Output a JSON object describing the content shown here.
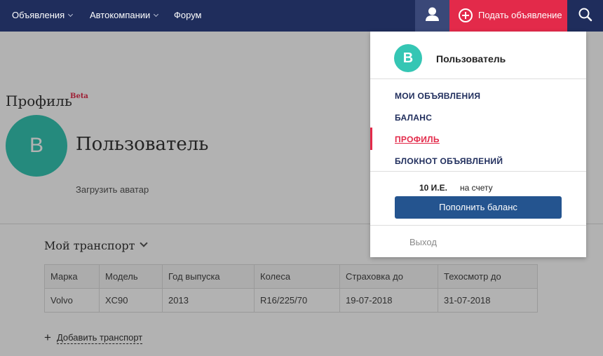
{
  "topnav": {
    "items": [
      {
        "label": "Объявления"
      },
      {
        "label": "Автокомпании"
      },
      {
        "label": "Форум"
      }
    ],
    "post_ad_label": "Подать объявление"
  },
  "profile": {
    "title": "Профиль",
    "beta": "Beta",
    "avatar_letter": "В",
    "user_name": "Пользователь",
    "upload_avatar": "Загрузить аватар"
  },
  "transport": {
    "title": "Мой транспорт",
    "columns": [
      "Марка",
      "Модель",
      "Год выпуска",
      "Колеса",
      "Страховка до",
      "Техосмотр до"
    ],
    "rows": [
      [
        "Volvo",
        "XC90",
        "2013",
        "R16/225/70",
        "19-07-2018",
        "31-07-2018"
      ]
    ],
    "add_label": "Добавить транспорт"
  },
  "dropdown": {
    "avatar_letter": "В",
    "user_name": "Пользователь",
    "menu": [
      {
        "label": "МОИ ОБЪЯВЛЕНИЯ",
        "active": false
      },
      {
        "label": "БАЛАНС",
        "active": false
      },
      {
        "label": "ПРОФИЛЬ",
        "active": true
      },
      {
        "label": "БЛОКНОТ ОБЪЯВЛЕНИЙ",
        "active": false
      }
    ],
    "balance_amount": "10 И.Е.",
    "balance_suffix": "на счету",
    "topup_label": "Пополнить баланс",
    "logout_label": "Выход"
  },
  "colors": {
    "nav_bg": "#1f2d5c",
    "accent_red": "#e32a4a",
    "avatar_teal": "#35c6b4",
    "button_blue": "#24548f"
  }
}
